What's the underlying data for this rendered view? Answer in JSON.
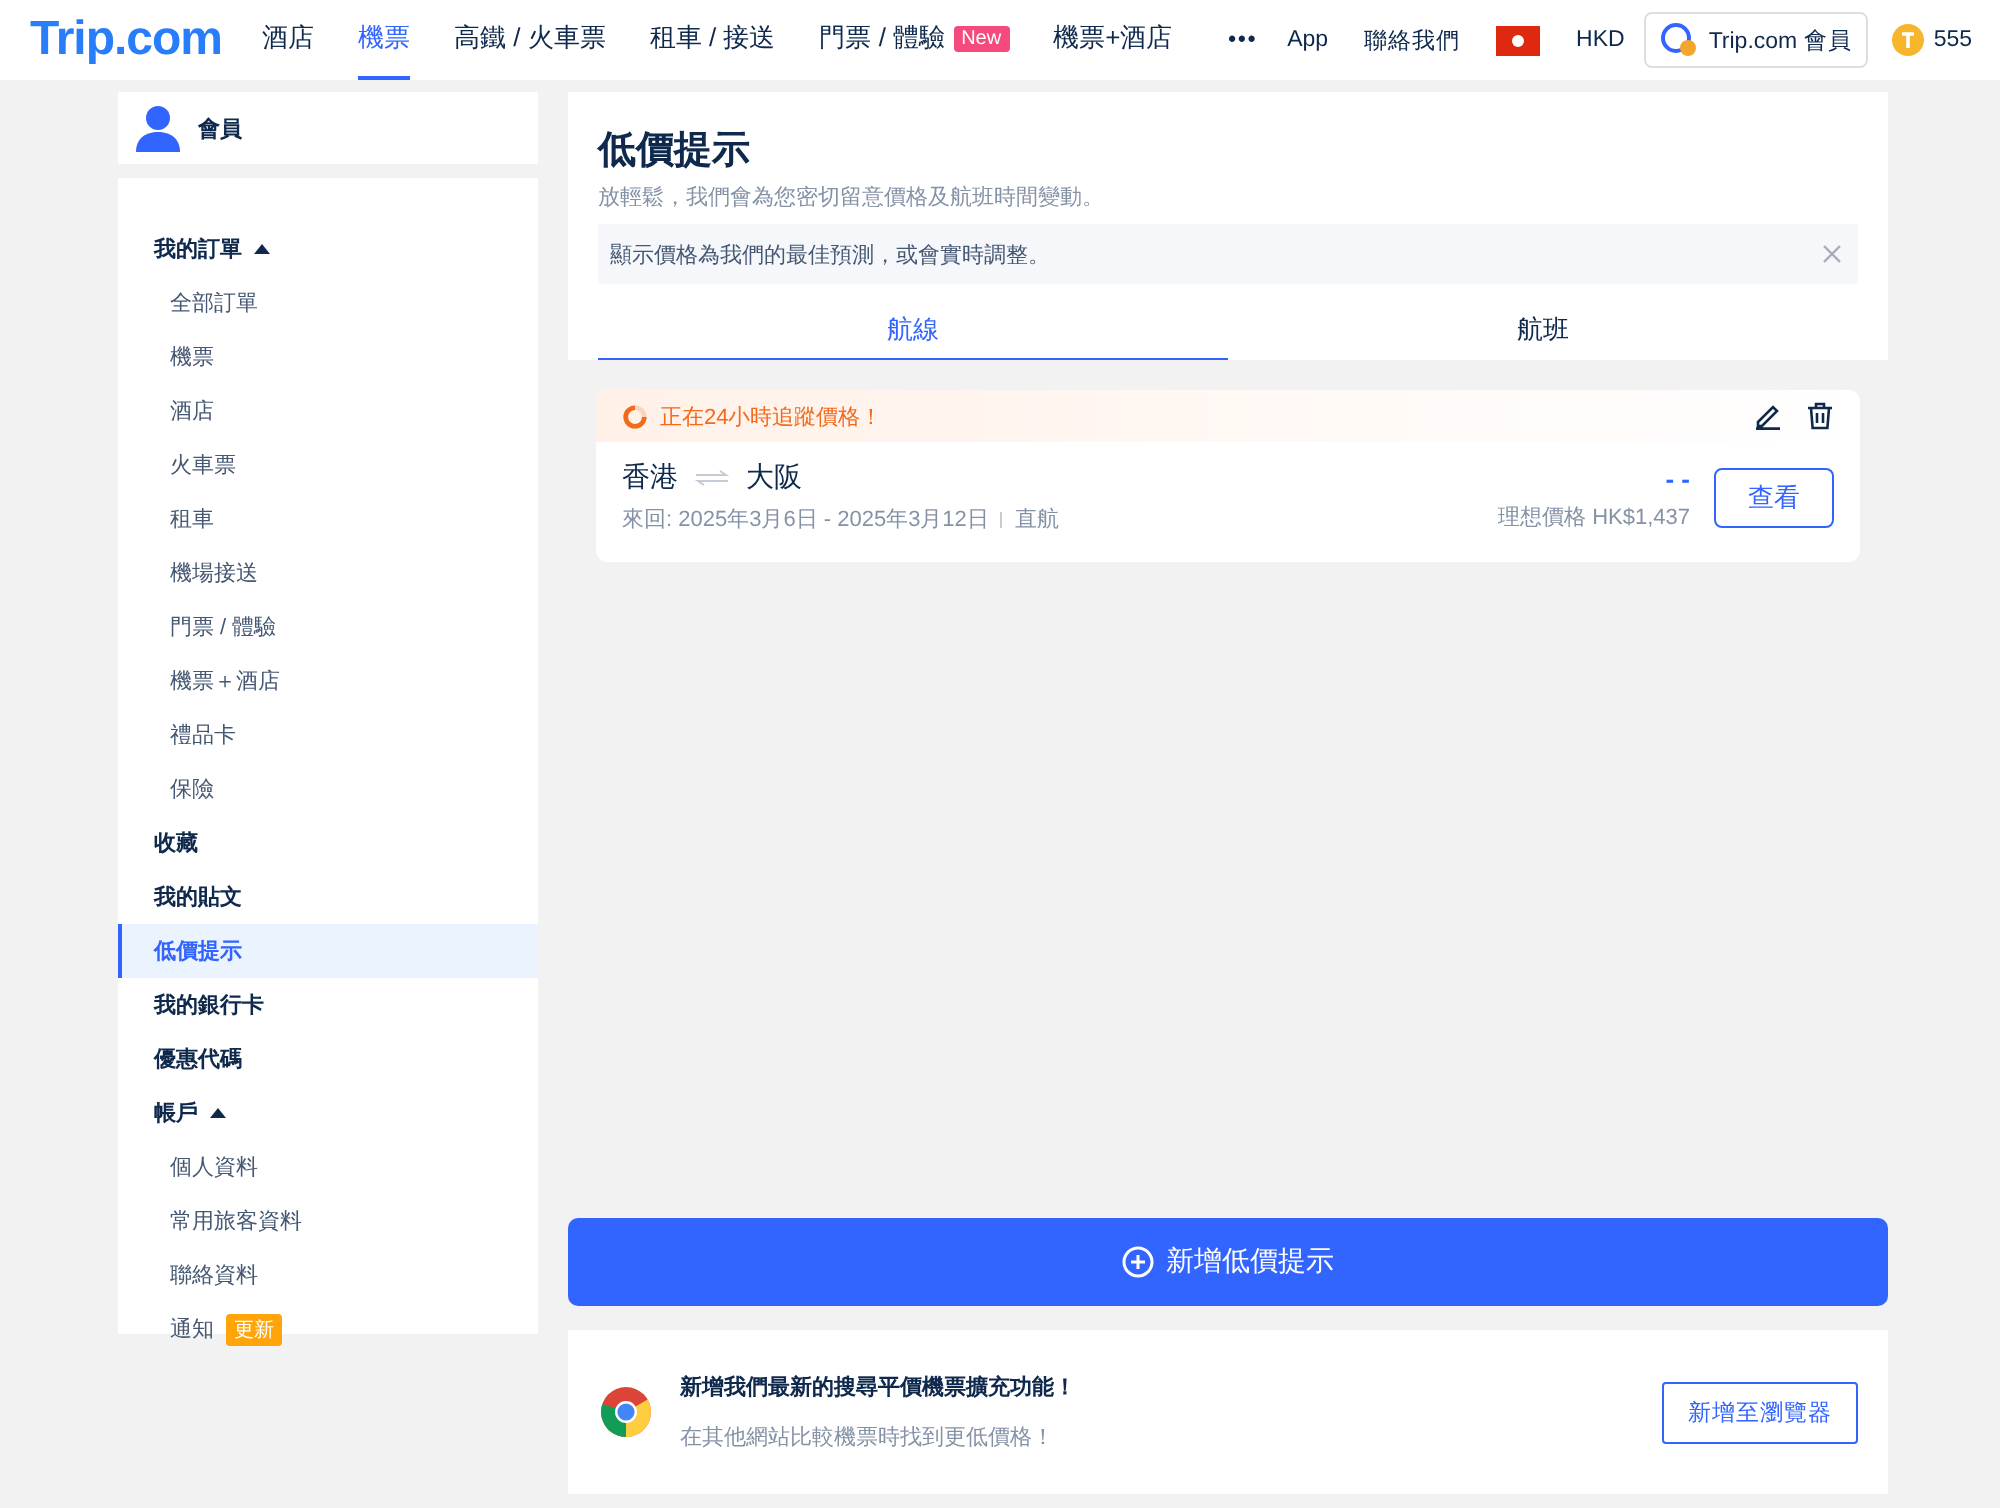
{
  "header": {
    "logo": "Trip.com",
    "nav": [
      {
        "label": "酒店",
        "selected": false
      },
      {
        "label": "機票",
        "selected": true
      },
      {
        "label": "高鐵 / 火車票",
        "selected": false
      },
      {
        "label": "租車 / 接送",
        "selected": false
      },
      {
        "label": "門票 / 體驗",
        "selected": false,
        "badge": "New"
      },
      {
        "label": "機票+酒店",
        "selected": false
      }
    ],
    "more": "•••",
    "app": "App",
    "contact": "聯絡我們",
    "currency": "HKD",
    "member_button": "Trip.com 會員",
    "points": "555"
  },
  "sidebar": {
    "member": "會員",
    "items": [
      {
        "label": "我的訂單",
        "selected": false,
        "expanded": true,
        "children": [
          {
            "label": "全部訂單",
            "selected": false
          },
          {
            "label": "機票",
            "selected": false
          },
          {
            "label": "酒店",
            "selected": false
          },
          {
            "label": "火車票",
            "selected": false
          },
          {
            "label": "租車",
            "selected": false
          },
          {
            "label": "機場接送",
            "selected": false
          },
          {
            "label": "門票 / 體驗",
            "selected": false
          },
          {
            "label": "機票＋酒店",
            "selected": false
          },
          {
            "label": "禮品卡",
            "selected": false
          },
          {
            "label": "保險",
            "selected": false
          }
        ]
      },
      {
        "label": "收藏",
        "selected": false
      },
      {
        "label": "我的貼文",
        "selected": false
      },
      {
        "label": "低價提示",
        "selected": true
      },
      {
        "label": "我的銀行卡",
        "selected": false
      },
      {
        "label": "優惠代碼",
        "selected": false
      },
      {
        "label": "帳戶",
        "selected": false,
        "expanded": true,
        "children": [
          {
            "label": "個人資料",
            "selected": false
          },
          {
            "label": "常用旅客資料",
            "selected": false
          },
          {
            "label": "聯絡資料",
            "selected": false
          },
          {
            "label": "通知",
            "selected": false,
            "badge": "更新"
          }
        ]
      }
    ]
  },
  "main": {
    "title": "低價提示",
    "subtitle": "放輕鬆，我們會為您密切留意價格及航班時間變動。",
    "notice": "顯示價格為我們的最佳預測，或會實時調整。",
    "tabs": [
      {
        "label": "航線",
        "selected": true
      },
      {
        "label": "航班",
        "selected": false
      }
    ],
    "alerts": [
      {
        "tracking": "正在24小時追蹤價格！",
        "from": "香港",
        "to": "大阪",
        "details": "來回:  2025年3月6日 - 2025年3月12日",
        "stops": "直航",
        "current_price": "- -",
        "target_price": "理想價格 HK$1,437",
        "view_button": "查看"
      }
    ],
    "add_button": "新增低價提示",
    "extension": {
      "title": "新增我們最新的搜尋平價機票擴充功能！",
      "text": "在其他網站比較機票時找到更低價格！",
      "button": "新增至瀏覽器"
    }
  }
}
